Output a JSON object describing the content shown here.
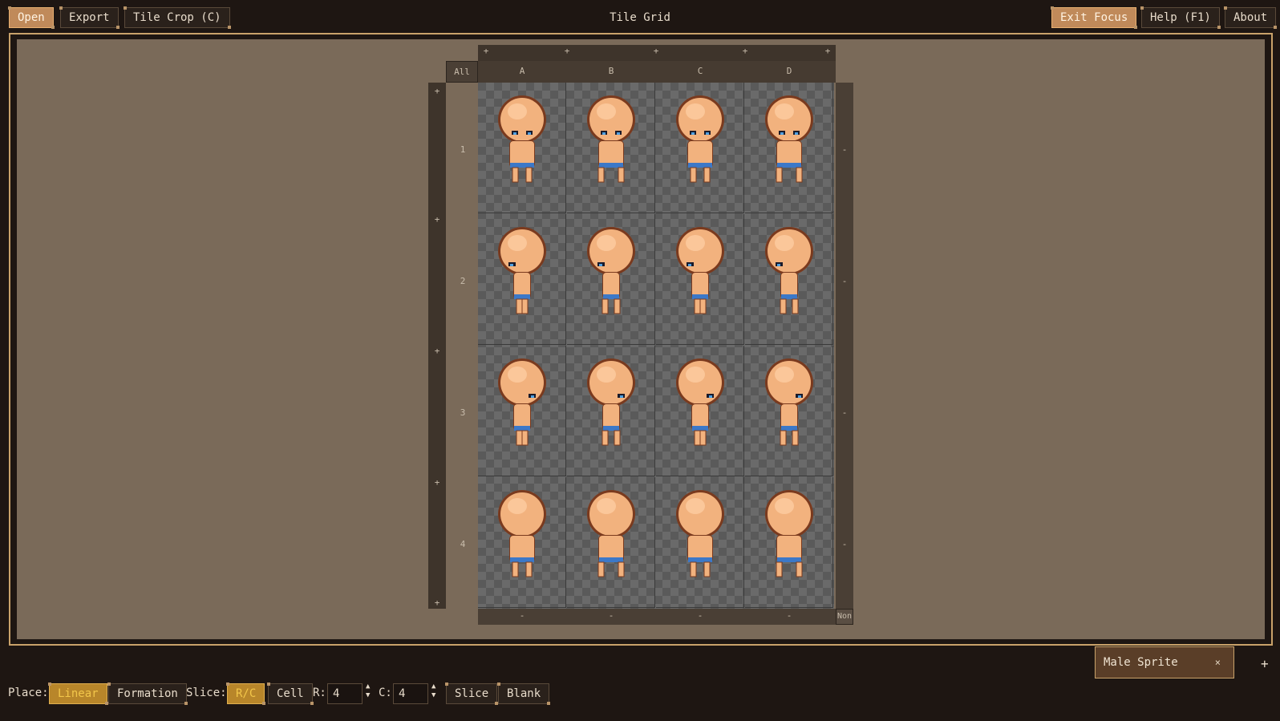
{
  "toolbar": {
    "open": "Open",
    "export": "Export",
    "tile_crop": "Tile Crop (C)",
    "exit_focus": "Exit Focus",
    "help": "Help (F1)",
    "about": "About"
  },
  "title": "Tile Grid",
  "grid": {
    "all_label": "All",
    "none_label": "Non",
    "columns": [
      "A",
      "B",
      "C",
      "D"
    ],
    "rows": [
      "1",
      "2",
      "3",
      "4"
    ],
    "add": "+",
    "remove": "-"
  },
  "tabs": {
    "active": "Male Sprite",
    "close": "×",
    "add": "+"
  },
  "bottom": {
    "place_label": "Place:",
    "linear": "Linear",
    "formation": "Formation",
    "slice_label": "Slice:",
    "rc": "R/C",
    "cell": "Cell",
    "r_label": "R:",
    "r_value": "4",
    "c_label": "C:",
    "c_value": "4",
    "slice_btn": "Slice",
    "blank_btn": "Blank"
  },
  "colors": {
    "accent": "#c08a5a",
    "active_yellow": "#f2c64a",
    "canvas": "#7a6a59",
    "frame": "#c9a26a"
  },
  "sprite": {
    "icon": "male-character-sprite",
    "skin": "#f2b27e",
    "shorts": "#3c78c8"
  }
}
